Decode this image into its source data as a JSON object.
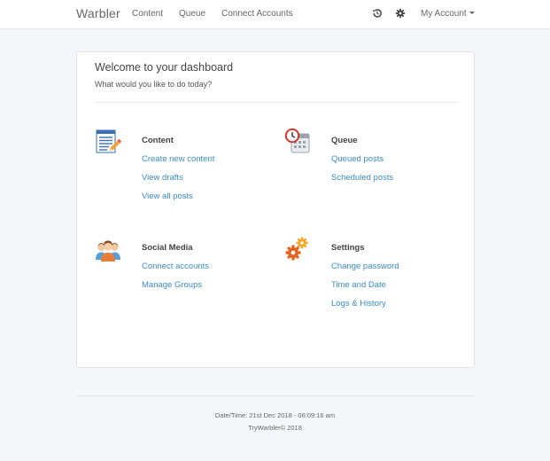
{
  "navbar": {
    "brand": "Warbler",
    "links": [
      "Content",
      "Queue",
      "Connect Accounts"
    ],
    "icons": [
      "history-icon",
      "gear-icon"
    ],
    "account_label": "My Account"
  },
  "dashboard": {
    "title": "Welcome to your dashboard",
    "subtitle": "What would you like to do today?",
    "sections": {
      "content": {
        "title": "Content",
        "icon": "document-pencil-icon",
        "links": [
          "Create new content",
          "View drafts",
          "View all posts"
        ]
      },
      "queue": {
        "title": "Queue",
        "icon": "clock-calendar-icon",
        "links": [
          "Queued posts",
          "Scheduled posts"
        ]
      },
      "social": {
        "title": "Social Media",
        "icon": "people-icon",
        "links": [
          "Connect accounts",
          "Manage Groups"
        ]
      },
      "settings": {
        "title": "Settings",
        "icon": "gears-icon",
        "links": [
          "Change password",
          "Time and Date",
          "Logs & History"
        ]
      }
    }
  },
  "footer": {
    "datetime": "Date/Time: 21st Dec 2018 - 06:09:16 am",
    "copyright": "TryWarbler© 2018"
  },
  "colors": {
    "background": "#f4f7fa",
    "link": "#3c8dc5",
    "panel": "#ffffff"
  }
}
